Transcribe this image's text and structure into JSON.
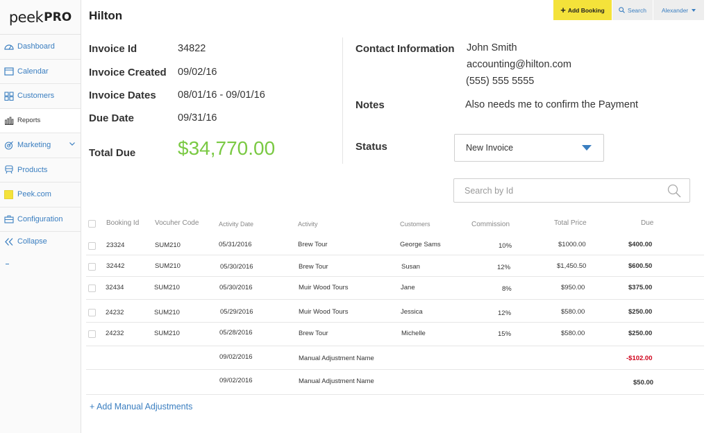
{
  "brand": {
    "logo_peek": "peek",
    "logo_pro": "PRO"
  },
  "sidebar": {
    "items": [
      {
        "label": "Dashboard",
        "icon": "dashboard-icon"
      },
      {
        "label": "Calendar",
        "icon": "calendar-icon"
      },
      {
        "label": "Customers",
        "icon": "customers-icon"
      },
      {
        "label": "Reports",
        "icon": "reports-icon"
      },
      {
        "label": "Marketing",
        "icon": "marketing-icon"
      },
      {
        "label": "Products",
        "icon": "products-icon"
      },
      {
        "label": "Peek.com",
        "icon": "peek-com-icon"
      },
      {
        "label": "Configuration",
        "icon": "configuration-icon"
      },
      {
        "label": "Collapse",
        "icon": "collapse-icon"
      }
    ]
  },
  "topbar": {
    "add_booking": "Add Booking",
    "search": "Search",
    "user": "Alexander"
  },
  "page": {
    "title": "Hilton"
  },
  "invoice": {
    "id_label": "Invoice Id",
    "id": "34822",
    "created_label": "Invoice Created",
    "created": "09/02/16",
    "dates_label": "Invoice Dates",
    "dates": "08/01/16 - 09/01/16",
    "due_label": "Due Date",
    "due": "09/31/16",
    "total_label": "Total Due",
    "total": "$34,770.00"
  },
  "contact": {
    "label": "Contact Information",
    "name": "John Smith",
    "email": "accounting@hilton.com",
    "phone": "(555) 555 5555"
  },
  "notes": {
    "label": "Notes",
    "text": "Also needs me to confirm the Payment"
  },
  "status": {
    "label": "Status",
    "value": "New Invoice"
  },
  "search": {
    "placeholder": "Search by Id"
  },
  "table": {
    "headers": [
      "Booking Id",
      "Vocuher Code",
      "Activity Date",
      "Activity",
      "Customers",
      "Commission",
      "Total Price",
      "Due"
    ],
    "rows": [
      {
        "booking_id": "23324",
        "voucher": "SUM210",
        "date": "05/31/2016",
        "activity": "Brew Tour",
        "customer": "George Sams",
        "commission": "10%",
        "total": "$1000.00",
        "due": "$400.00"
      },
      {
        "booking_id": "32442",
        "voucher": "SUM210",
        "date": "05/30/2016",
        "activity": "Brew Tour",
        "customer": "Susan",
        "commission": "12%",
        "total": "$1,450.50",
        "due": "$600.50"
      },
      {
        "booking_id": "32434",
        "voucher": "SUM210",
        "date": "05/30/2016",
        "activity": "Muir Wood Tours",
        "customer": "Jane",
        "commission": "8%",
        "total": "$950.00",
        "due": "$375.00"
      },
      {
        "booking_id": "24232",
        "voucher": "SUM210",
        "date": "05/29/2016",
        "activity": "Muir Wood Tours",
        "customer": "Jessica",
        "commission": "12%",
        "total": "$580.00",
        "due": "$250.00"
      },
      {
        "booking_id": "24232",
        "voucher": "SUM210",
        "date": "05/28/2016",
        "activity": "Brew Tour",
        "customer": "Michelle",
        "commission": "15%",
        "total": "$580.00",
        "due": "$250.00"
      }
    ],
    "adjustments": [
      {
        "date": "09/02/2016",
        "name": "Manual Adjustment Name",
        "due": "-$102.00"
      },
      {
        "date": "09/02/2016",
        "name": "Manual Adjustment Name",
        "due": "$50.00"
      }
    ]
  },
  "actions": {
    "add_adjustments": "+ Add Manual Adjustments"
  },
  "colors": {
    "accent": "#3a7ec0",
    "total": "#7ac943",
    "add_button": "#f4e23a",
    "negative": "#d0021b"
  }
}
